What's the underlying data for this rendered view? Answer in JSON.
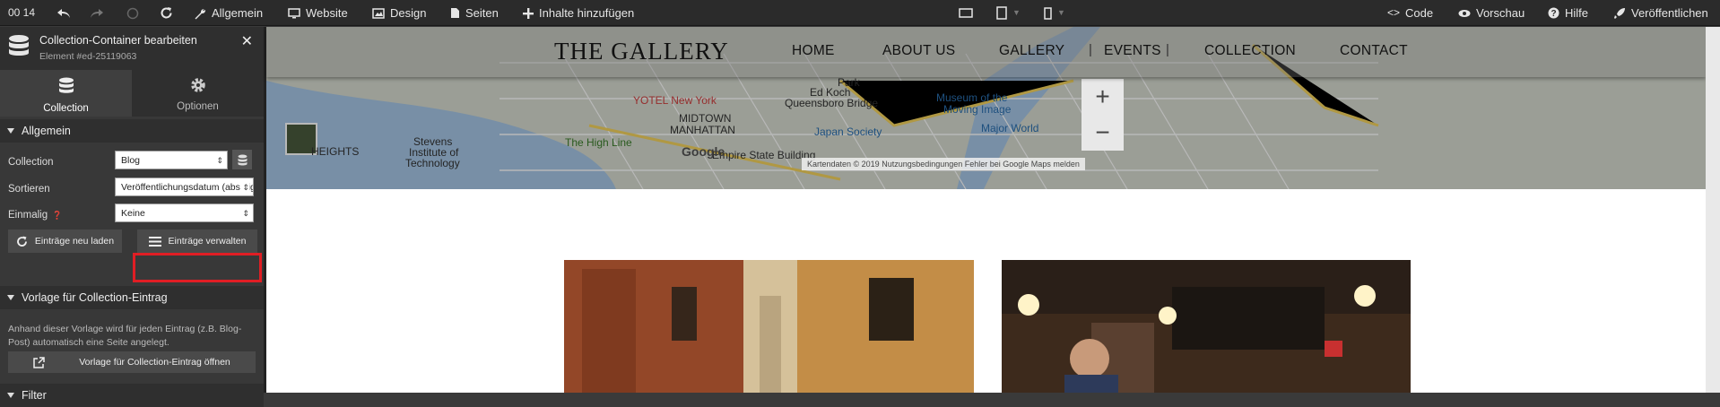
{
  "toolbar": {
    "time": "00 14",
    "general": "Allgemein",
    "website": "Website",
    "design": "Design",
    "pages": "Seiten",
    "add_content": "Inhalte hinzufügen",
    "code": "Code",
    "preview": "Vorschau",
    "help": "Hilfe",
    "publish": "Veröffentlichen"
  },
  "panel": {
    "title": "Collection-Container bearbeiten",
    "subtitle": "Element #ed-25119063",
    "tab_collection": "Collection",
    "tab_options": "Optionen",
    "section_general": "Allgemein",
    "collection_label": "Collection",
    "collection_value": "Blog",
    "sort_label": "Sortieren",
    "sort_value": "Veröffentlichungsdatum (absteigend)",
    "once_label": "Einmalig",
    "once_value": "Keine",
    "reload_button": "Einträge neu laden",
    "manage_button": "Einträge verwalten",
    "section_template": "Vorlage für Collection-Eintrag",
    "template_desc": "Anhand dieser Vorlage wird für jeden Eintrag (z.B. Blog-Post) automatisch eine Seite angelegt.",
    "open_template_button": "Vorlage für Collection-Eintrag öffnen",
    "section_filter": "Filter"
  },
  "site": {
    "logo": "THE GALLERY",
    "nav": [
      "HOME",
      "ABOUT US",
      "GALLERY",
      "EVENTS",
      "COLLECTION",
      "CONTACT"
    ]
  },
  "map": {
    "labels": {
      "heights": "HEIGHTS",
      "yotel": "YOTEL New York",
      "midtown": "MIDTOWN",
      "manhattan": "MANHATTAN",
      "queensboro": "Queensboro Bridge",
      "edkoch": "Ed Koch",
      "museum": "Museum of the",
      "moving": "Moving Image",
      "japan": "Japan Society",
      "majorworld": "Major World",
      "stevens": "Stevens",
      "institute": "Institute of",
      "technology": "Technology",
      "highline": "The High Line",
      "empire": "Empire State Building",
      "google": "Google",
      "park": "Park"
    },
    "footer": "Kartendaten © 2019   Nutzungsbedingungen     Fehler bei Google Maps melden",
    "zoom_in": "+",
    "zoom_out": "−"
  }
}
